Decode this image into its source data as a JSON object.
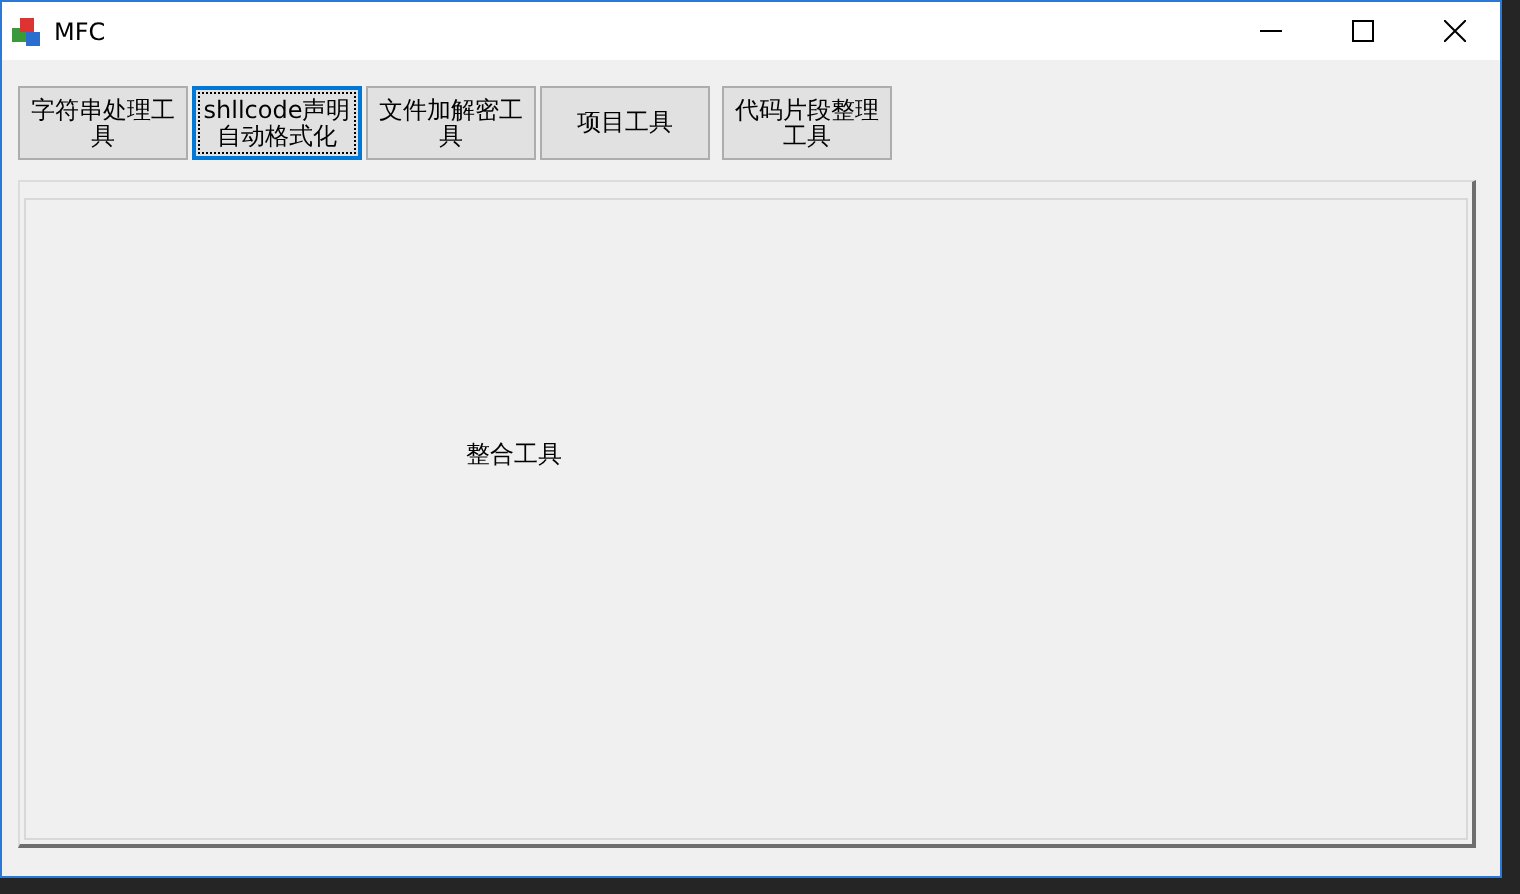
{
  "window": {
    "title": "MFC"
  },
  "buttons": [
    {
      "label": "字符串处理工具",
      "selected": false
    },
    {
      "label": "shllcode声明自动格式化",
      "selected": true
    },
    {
      "label": "文件加解密工具",
      "selected": false
    },
    {
      "label": "项目工具",
      "selected": false
    },
    {
      "label": "代码片段整理工具",
      "selected": false
    }
  ],
  "panel": {
    "label": "整合工具"
  }
}
